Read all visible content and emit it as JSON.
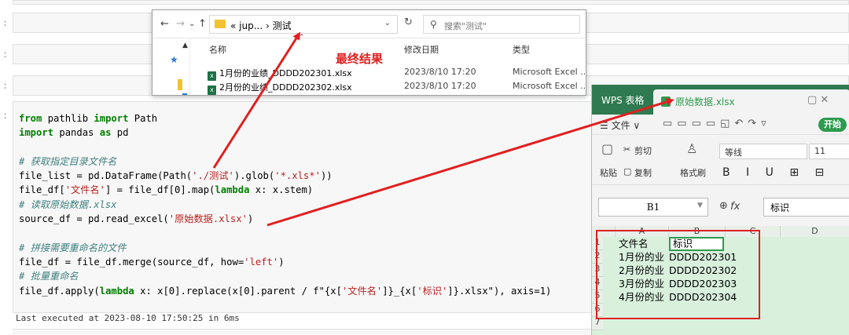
{
  "jupyter": {
    "prompt_char": ":",
    "code_lines": [
      [
        {
          "t": "from",
          "c": "kw"
        },
        {
          "t": " pathlib ",
          "c": ""
        },
        {
          "t": "import",
          "c": "kw"
        },
        {
          "t": " Path",
          "c": ""
        }
      ],
      [
        {
          "t": "import",
          "c": "kw"
        },
        {
          "t": " pandas ",
          "c": ""
        },
        {
          "t": "as",
          "c": "kw"
        },
        {
          "t": " pd",
          "c": ""
        }
      ],
      [],
      [
        {
          "t": "# 获取指定目录文件名",
          "c": "cm"
        }
      ],
      [
        {
          "t": "file_list = pd.DataFrame(Path(",
          "c": ""
        },
        {
          "t": "'./测试'",
          "c": "st"
        },
        {
          "t": ").glob(",
          "c": ""
        },
        {
          "t": "'*.xls*'",
          "c": "st"
        },
        {
          "t": "))",
          "c": ""
        }
      ],
      [
        {
          "t": "file_df[",
          "c": ""
        },
        {
          "t": "'文件名'",
          "c": "st"
        },
        {
          "t": "] = file_df[",
          "c": ""
        },
        {
          "t": "0",
          "c": ""
        },
        {
          "t": "].map(",
          "c": ""
        },
        {
          "t": "lambda",
          "c": "kw"
        },
        {
          "t": " x: x.stem)",
          "c": ""
        }
      ],
      [
        {
          "t": "# 读取原始数据.xlsx",
          "c": "cm"
        }
      ],
      [
        {
          "t": "source_df = pd.read_excel(",
          "c": ""
        },
        {
          "t": "'原始数据.xlsx'",
          "c": "st"
        },
        {
          "t": ")",
          "c": ""
        }
      ],
      [],
      [
        {
          "t": "# 拼接需要重命名的文件",
          "c": "cm"
        }
      ],
      [
        {
          "t": "file_df = file_df.merge(source_df, how=",
          "c": ""
        },
        {
          "t": "'left'",
          "c": "st"
        },
        {
          "t": ")",
          "c": ""
        }
      ],
      [
        {
          "t": "# 批量重命名",
          "c": "cm"
        }
      ],
      [
        {
          "t": "file_df.apply(",
          "c": ""
        },
        {
          "t": "lambda",
          "c": "kw"
        },
        {
          "t": " x: x[",
          "c": ""
        },
        {
          "t": "0",
          "c": ""
        },
        {
          "t": "].replace(x[",
          "c": ""
        },
        {
          "t": "0",
          "c": ""
        },
        {
          "t": "].parent / f\"{x[",
          "c": ""
        },
        {
          "t": "'文件名'",
          "c": "st"
        },
        {
          "t": "]}_{x[",
          "c": ""
        },
        {
          "t": "'标识'",
          "c": "st"
        },
        {
          "t": "]}.xlsx\"), axis=",
          "c": ""
        },
        {
          "t": "1",
          "c": ""
        },
        {
          "t": ")",
          "c": ""
        }
      ]
    ],
    "exec_text": "Last executed at 2023-08-10 17:50:25 in 6ms"
  },
  "explorer": {
    "nav": {
      "back": "←",
      "forward": "→",
      "dropdown": "⌄",
      "up": "↑"
    },
    "address": "« jup... › 测试",
    "refresh": "↻",
    "search_placeholder": "搜索\"测试\"",
    "columns": {
      "name": "名称",
      "modified": "修改日期",
      "type": "类型"
    },
    "files": [
      {
        "name": "1月份的业绩_DDDD202301.xlsx",
        "modified": "2023/8/10 17:20",
        "type": "Microsoft Excel ..."
      },
      {
        "name": "2月份的业绩_DDDD202302.xlsx",
        "modified": "2023/8/10 17:20",
        "type": "Microsoft Excel ..."
      }
    ]
  },
  "annotation": {
    "result_label": "最终结果",
    "color": "#e02020"
  },
  "wps": {
    "app_tab": "WPS 表格",
    "file_tab": "原始数据.xlsx",
    "tab_controls": "▢ ✕",
    "menu_file": "☰ 文件 ∨",
    "start_tab": "开始",
    "ribbon": {
      "paste": "粘贴",
      "cut": "剪切",
      "copy": "复制",
      "format_painter": "格式刷",
      "font": "等线",
      "font_size": "11",
      "format_buttons": "B I U ⊞ ⊟"
    },
    "name_box": "B1",
    "fx": "fx",
    "formula_value": "标识",
    "columns": [
      "A",
      "B",
      "C",
      "D"
    ],
    "rows": [
      {
        "num": "1",
        "a": "文件名",
        "b": "标识"
      },
      {
        "num": "2",
        "a": "1月份的业",
        "b": "DDDD202301"
      },
      {
        "num": "3",
        "a": "2月份的业",
        "b": "DDDD202302"
      },
      {
        "num": "4",
        "a": "3月份的业",
        "b": "DDDD202303"
      },
      {
        "num": "5",
        "a": "4月份的业",
        "b": "DDDD202304"
      },
      {
        "num": "6",
        "a": "",
        "b": ""
      },
      {
        "num": "7",
        "a": "",
        "b": ""
      }
    ],
    "accent": "#2e9b4e"
  }
}
